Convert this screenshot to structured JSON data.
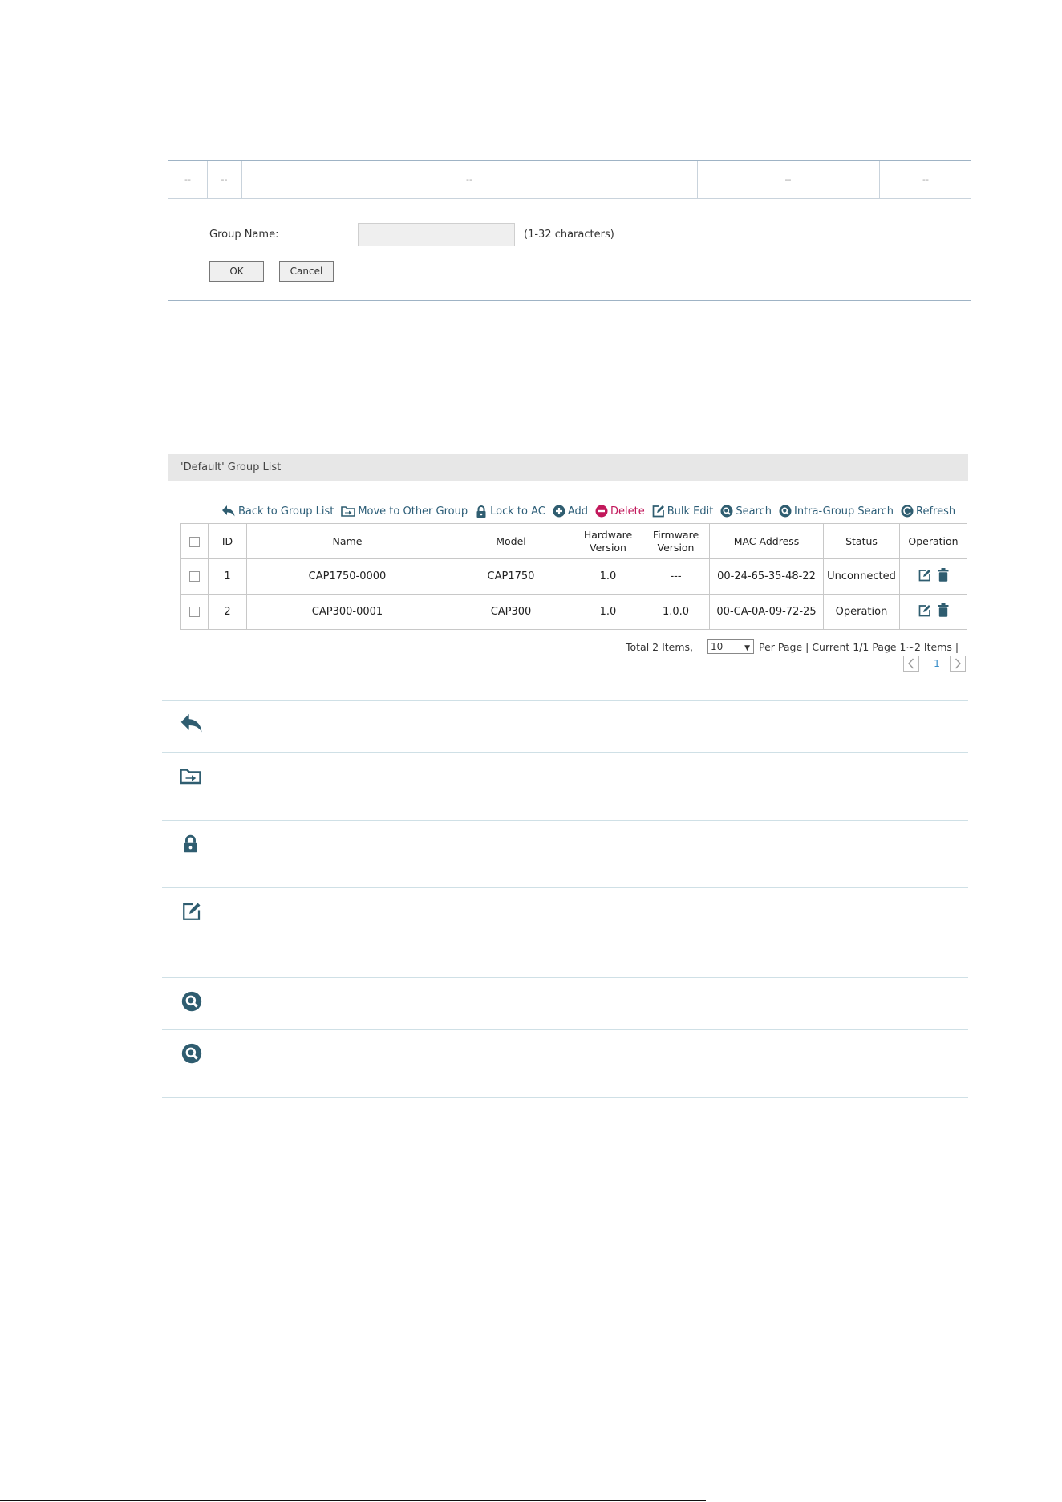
{
  "edit_panel": {
    "dash_cells": [
      "--",
      "--",
      "--",
      "--",
      "--"
    ],
    "group_name_label": "Group Name:",
    "group_name_value": "",
    "group_name_hint": "(1-32 characters)",
    "ok_label": "OK",
    "cancel_label": "Cancel"
  },
  "group_list": {
    "title": "'Default' Group List",
    "toolbar": [
      {
        "label": "Back to Group List",
        "icon": "back-arrow-icon"
      },
      {
        "label": "Move to Other Group",
        "icon": "move-folder-icon"
      },
      {
        "label": "Lock to AC",
        "icon": "lock-icon"
      },
      {
        "label": "Add",
        "icon": "plus-circle-icon"
      },
      {
        "label": "Delete",
        "icon": "minus-circle-icon"
      },
      {
        "label": "Bulk Edit",
        "icon": "edit-icon"
      },
      {
        "label": "Search",
        "icon": "search-icon"
      },
      {
        "label": "Intra-Group Search",
        "icon": "search-icon"
      },
      {
        "label": "Refresh",
        "icon": "refresh-icon"
      }
    ],
    "columns": {
      "id": "ID",
      "name": "Name",
      "model": "Model",
      "hw_1": "Hardware",
      "hw_2": "Version",
      "fw_1": "Firmware",
      "fw_2": "Version",
      "mac": "MAC Address",
      "status": "Status",
      "operation": "Operation"
    },
    "rows": [
      {
        "id": "1",
        "name": "CAP1750-0000",
        "model": "CAP1750",
        "hw": "1.0",
        "fw": "---",
        "mac": "00-24-65-35-48-22",
        "status": "Unconnected"
      },
      {
        "id": "2",
        "name": "CAP300-0001",
        "model": "CAP300",
        "hw": "1.0",
        "fw": "1.0.0",
        "mac": "00-CA-0A-09-72-25",
        "status": "Operation"
      }
    ],
    "pager": {
      "total": "Total 2 Items,",
      "per_page_value": "10",
      "per_page_arrow": "▼",
      "per_page_suffix": "Per Page | Current 1/1 Page 1~2 Items |",
      "current_page": "1"
    }
  },
  "legend_icons": [
    "back-arrow-icon",
    "move-folder-icon",
    "lock-icon",
    "edit-icon",
    "search-icon",
    "search-icon"
  ],
  "colors": {
    "icon": "#2f5d70",
    "delete": "#c2185b",
    "page_link": "#3b8fc9",
    "panel_border": "#9fb3c5"
  }
}
